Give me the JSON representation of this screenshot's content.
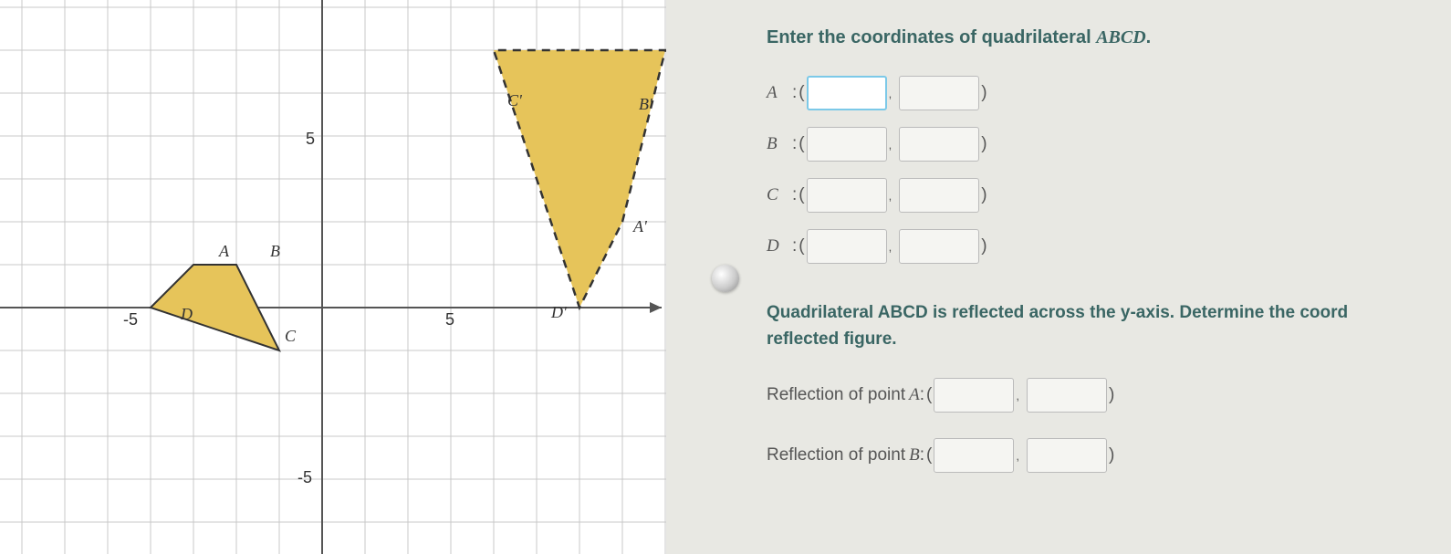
{
  "prompt": "Enter the coordinates of quadrilateral ",
  "prompt_math": "ABCD",
  "prompt_end": ".",
  "points": {
    "A": {
      "label": "A"
    },
    "B": {
      "label": "B"
    },
    "C": {
      "label": "C"
    },
    "D": {
      "label": "D"
    }
  },
  "p_open": "(",
  "p_close": ")",
  "comma": ",",
  "colon": ":",
  "sub_prompt_1": "Quadrilateral ",
  "sub_prompt_math": "ABCD",
  "sub_prompt_2": " is reflected across the ",
  "sub_prompt_y": "y",
  "sub_prompt_3": "-axis. Determine the coord",
  "sub_prompt_4": "reflected figure.",
  "reflections": {
    "A": {
      "label": "Reflection of point ",
      "pt": "A"
    },
    "B": {
      "label": "Reflection of point ",
      "pt": "B"
    }
  },
  "axis": {
    "neg5": "-5",
    "pos5": "5"
  },
  "graph_labels": {
    "A": "A",
    "B": "B",
    "C": "C",
    "D": "D",
    "Ap": "A'",
    "Bp": "B'",
    "Cp": "C'",
    "Dp": "D'"
  },
  "chart_data": {
    "type": "scatter",
    "title": "",
    "xlabel": "",
    "ylabel": "",
    "xlim": [
      -7,
      8
    ],
    "ylim": [
      -6,
      7
    ],
    "grid": true,
    "series": [
      {
        "name": "ABCD",
        "points": {
          "A": [
            -3,
            1
          ],
          "B": [
            -2,
            1
          ],
          "C": [
            -1,
            -1
          ],
          "D": [
            -4,
            0
          ]
        },
        "style": "solid",
        "fill": "#e6c45a"
      },
      {
        "name": "A'B'C'D'",
        "points": {
          "A'": [
            7,
            2
          ],
          "B'": [
            8,
            6
          ],
          "C'": [
            4,
            6
          ],
          "D'": [
            6,
            0
          ]
        },
        "style": "dashed",
        "fill": "#e6c45a"
      }
    ]
  }
}
